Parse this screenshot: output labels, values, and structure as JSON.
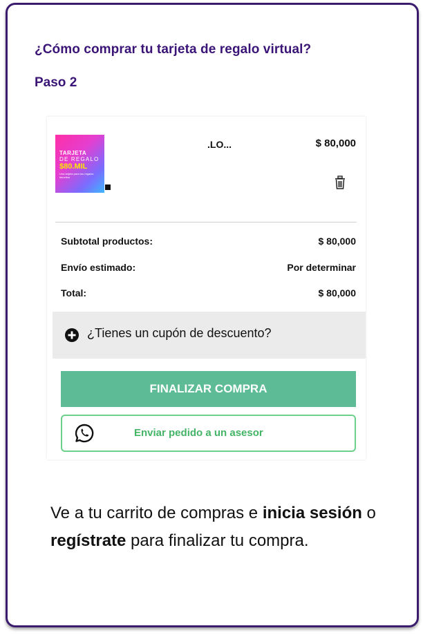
{
  "card": {
    "title": "¿Cómo comprar tu tarjeta de regalo virtual?",
    "step": "Paso 2"
  },
  "cart": {
    "product": {
      "thumb_line1": "TARJETA",
      "thumb_line2": "DE REGALO",
      "thumb_amount": "$80.MIL",
      "thumb_small": "Una tarjeta para tus regalos favoritos",
      "name": ".LO...",
      "price": "$ 80,000"
    },
    "summary": [
      {
        "label": "Subtotal productos:",
        "value": "$ 80,000"
      },
      {
        "label": "Envío estimado:",
        "value": "Por determinar"
      },
      {
        "label": "Total:",
        "value": "$ 80,000"
      }
    ],
    "coupon_label": "¿Tienes un cupón de descuento?",
    "finish_label": "FINALIZAR COMPRA",
    "advisor_label": "Enviar pedido a un asesor"
  },
  "description": {
    "part1": "Ve a tu carrito de compras e ",
    "bold1": "inicia sesión",
    "part2": " o ",
    "bold2": "regístrate",
    "part3": " para finalizar tu compra."
  },
  "colors": {
    "brand_purple": "#3a1476",
    "finish_green": "#5dbb96",
    "whatsapp_green": "#44b466"
  }
}
